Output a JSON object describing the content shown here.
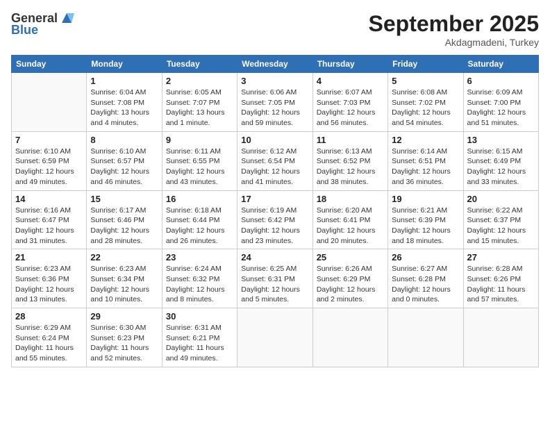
{
  "header": {
    "logo_line1": "General",
    "logo_line2": "Blue",
    "month": "September 2025",
    "location": "Akdagmadeni, Turkey"
  },
  "weekdays": [
    "Sunday",
    "Monday",
    "Tuesday",
    "Wednesday",
    "Thursday",
    "Friday",
    "Saturday"
  ],
  "weeks": [
    [
      {
        "day": "",
        "info": ""
      },
      {
        "day": "1",
        "info": "Sunrise: 6:04 AM\nSunset: 7:08 PM\nDaylight: 13 hours\nand 4 minutes."
      },
      {
        "day": "2",
        "info": "Sunrise: 6:05 AM\nSunset: 7:07 PM\nDaylight: 13 hours\nand 1 minute."
      },
      {
        "day": "3",
        "info": "Sunrise: 6:06 AM\nSunset: 7:05 PM\nDaylight: 12 hours\nand 59 minutes."
      },
      {
        "day": "4",
        "info": "Sunrise: 6:07 AM\nSunset: 7:03 PM\nDaylight: 12 hours\nand 56 minutes."
      },
      {
        "day": "5",
        "info": "Sunrise: 6:08 AM\nSunset: 7:02 PM\nDaylight: 12 hours\nand 54 minutes."
      },
      {
        "day": "6",
        "info": "Sunrise: 6:09 AM\nSunset: 7:00 PM\nDaylight: 12 hours\nand 51 minutes."
      }
    ],
    [
      {
        "day": "7",
        "info": "Sunrise: 6:10 AM\nSunset: 6:59 PM\nDaylight: 12 hours\nand 49 minutes."
      },
      {
        "day": "8",
        "info": "Sunrise: 6:10 AM\nSunset: 6:57 PM\nDaylight: 12 hours\nand 46 minutes."
      },
      {
        "day": "9",
        "info": "Sunrise: 6:11 AM\nSunset: 6:55 PM\nDaylight: 12 hours\nand 43 minutes."
      },
      {
        "day": "10",
        "info": "Sunrise: 6:12 AM\nSunset: 6:54 PM\nDaylight: 12 hours\nand 41 minutes."
      },
      {
        "day": "11",
        "info": "Sunrise: 6:13 AM\nSunset: 6:52 PM\nDaylight: 12 hours\nand 38 minutes."
      },
      {
        "day": "12",
        "info": "Sunrise: 6:14 AM\nSunset: 6:51 PM\nDaylight: 12 hours\nand 36 minutes."
      },
      {
        "day": "13",
        "info": "Sunrise: 6:15 AM\nSunset: 6:49 PM\nDaylight: 12 hours\nand 33 minutes."
      }
    ],
    [
      {
        "day": "14",
        "info": "Sunrise: 6:16 AM\nSunset: 6:47 PM\nDaylight: 12 hours\nand 31 minutes."
      },
      {
        "day": "15",
        "info": "Sunrise: 6:17 AM\nSunset: 6:46 PM\nDaylight: 12 hours\nand 28 minutes."
      },
      {
        "day": "16",
        "info": "Sunrise: 6:18 AM\nSunset: 6:44 PM\nDaylight: 12 hours\nand 26 minutes."
      },
      {
        "day": "17",
        "info": "Sunrise: 6:19 AM\nSunset: 6:42 PM\nDaylight: 12 hours\nand 23 minutes."
      },
      {
        "day": "18",
        "info": "Sunrise: 6:20 AM\nSunset: 6:41 PM\nDaylight: 12 hours\nand 20 minutes."
      },
      {
        "day": "19",
        "info": "Sunrise: 6:21 AM\nSunset: 6:39 PM\nDaylight: 12 hours\nand 18 minutes."
      },
      {
        "day": "20",
        "info": "Sunrise: 6:22 AM\nSunset: 6:37 PM\nDaylight: 12 hours\nand 15 minutes."
      }
    ],
    [
      {
        "day": "21",
        "info": "Sunrise: 6:23 AM\nSunset: 6:36 PM\nDaylight: 12 hours\nand 13 minutes."
      },
      {
        "day": "22",
        "info": "Sunrise: 6:23 AM\nSunset: 6:34 PM\nDaylight: 12 hours\nand 10 minutes."
      },
      {
        "day": "23",
        "info": "Sunrise: 6:24 AM\nSunset: 6:32 PM\nDaylight: 12 hours\nand 8 minutes."
      },
      {
        "day": "24",
        "info": "Sunrise: 6:25 AM\nSunset: 6:31 PM\nDaylight: 12 hours\nand 5 minutes."
      },
      {
        "day": "25",
        "info": "Sunrise: 6:26 AM\nSunset: 6:29 PM\nDaylight: 12 hours\nand 2 minutes."
      },
      {
        "day": "26",
        "info": "Sunrise: 6:27 AM\nSunset: 6:28 PM\nDaylight: 12 hours\nand 0 minutes."
      },
      {
        "day": "27",
        "info": "Sunrise: 6:28 AM\nSunset: 6:26 PM\nDaylight: 11 hours\nand 57 minutes."
      }
    ],
    [
      {
        "day": "28",
        "info": "Sunrise: 6:29 AM\nSunset: 6:24 PM\nDaylight: 11 hours\nand 55 minutes."
      },
      {
        "day": "29",
        "info": "Sunrise: 6:30 AM\nSunset: 6:23 PM\nDaylight: 11 hours\nand 52 minutes."
      },
      {
        "day": "30",
        "info": "Sunrise: 6:31 AM\nSunset: 6:21 PM\nDaylight: 11 hours\nand 49 minutes."
      },
      {
        "day": "",
        "info": ""
      },
      {
        "day": "",
        "info": ""
      },
      {
        "day": "",
        "info": ""
      },
      {
        "day": "",
        "info": ""
      }
    ]
  ]
}
